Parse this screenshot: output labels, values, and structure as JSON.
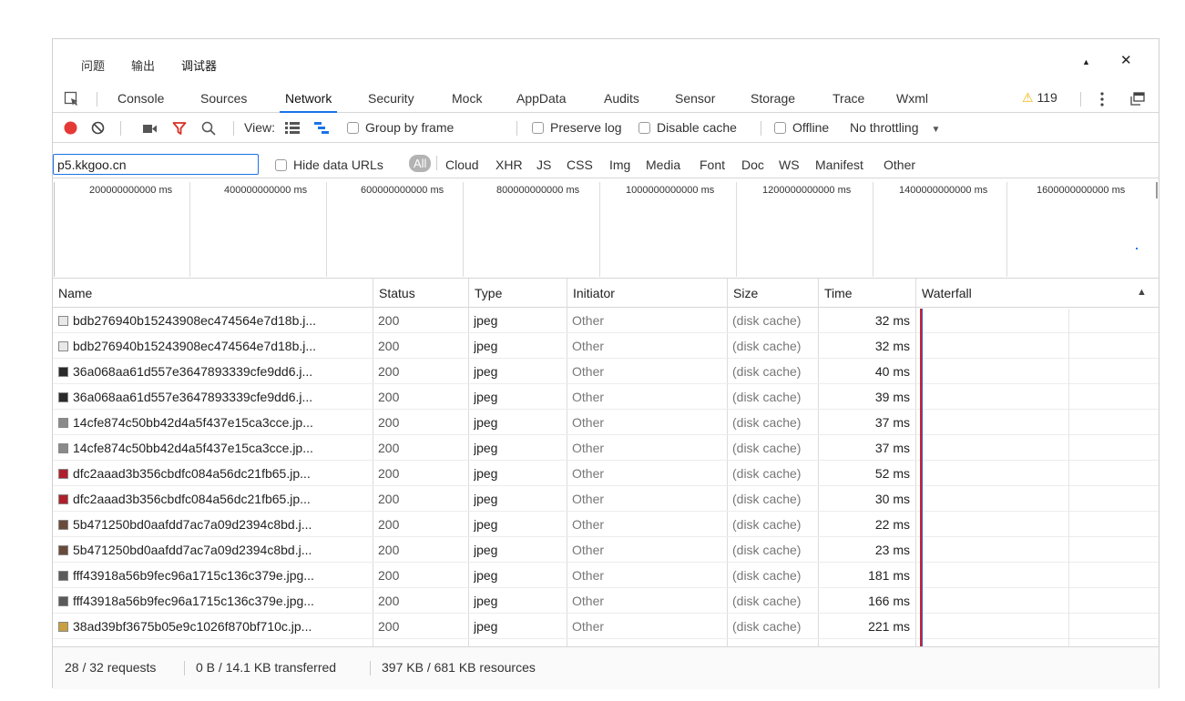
{
  "title_tabs": [
    {
      "label": "问题"
    },
    {
      "label": "输出"
    },
    {
      "label": "调试器"
    }
  ],
  "title_controls": {
    "collapse": "▲",
    "close": "✕"
  },
  "devtools_tabs": [
    {
      "label": "Console"
    },
    {
      "label": "Sources"
    },
    {
      "label": "Network"
    },
    {
      "label": "Security"
    },
    {
      "label": "Mock"
    },
    {
      "label": "AppData"
    },
    {
      "label": "Audits"
    },
    {
      "label": "Sensor"
    },
    {
      "label": "Storage"
    },
    {
      "label": "Trace"
    },
    {
      "label": "Wxml"
    }
  ],
  "warnings": {
    "icon": "⚠",
    "count": "119"
  },
  "toolbar": {
    "view_label": "View:",
    "group_by_frame": "Group by frame",
    "preserve_log": "Preserve log",
    "disable_cache": "Disable cache",
    "offline": "Offline",
    "throttling": "No throttling",
    "throttle_arrow": "▼"
  },
  "filter": {
    "value": "p5.kkgoo.cn",
    "hide_data_urls": "Hide data URLs",
    "all": "All",
    "types": [
      "Cloud",
      "XHR",
      "JS",
      "CSS",
      "Img",
      "Media",
      "Font",
      "Doc",
      "WS",
      "Manifest",
      "Other"
    ]
  },
  "overview_ticks": [
    "200000000000 ms",
    "400000000000 ms",
    "600000000000 ms",
    "800000000000 ms",
    "1000000000000 ms",
    "1200000000000 ms",
    "1400000000000 ms",
    "1600000000000 ms"
  ],
  "columns": {
    "name": "Name",
    "status": "Status",
    "type": "Type",
    "initiator": "Initiator",
    "size": "Size",
    "time": "Time",
    "waterfall": "Waterfall",
    "sort_arrow": "▲"
  },
  "rows": [
    {
      "name": "bdb276940b15243908ec474564e7d18b.j...",
      "status": "200",
      "type": "jpeg",
      "initiator": "Other",
      "size": "(disk cache)",
      "time": "32 ms",
      "icon_color": "#e8e8e8"
    },
    {
      "name": "bdb276940b15243908ec474564e7d18b.j...",
      "status": "200",
      "type": "jpeg",
      "initiator": "Other",
      "size": "(disk cache)",
      "time": "32 ms",
      "icon_color": "#e8e8e8"
    },
    {
      "name": "36a068aa61d557e3647893339cfe9dd6.j...",
      "status": "200",
      "type": "jpeg",
      "initiator": "Other",
      "size": "(disk cache)",
      "time": "40 ms",
      "icon_color": "#2a2a2a"
    },
    {
      "name": "36a068aa61d557e3647893339cfe9dd6.j...",
      "status": "200",
      "type": "jpeg",
      "initiator": "Other",
      "size": "(disk cache)",
      "time": "39 ms",
      "icon_color": "#2a2a2a"
    },
    {
      "name": "14cfe874c50bb42d4a5f437e15ca3cce.jp...",
      "status": "200",
      "type": "jpeg",
      "initiator": "Other",
      "size": "(disk cache)",
      "time": "37 ms",
      "icon_color": "#8a8a8a"
    },
    {
      "name": "14cfe874c50bb42d4a5f437e15ca3cce.jp...",
      "status": "200",
      "type": "jpeg",
      "initiator": "Other",
      "size": "(disk cache)",
      "time": "37 ms",
      "icon_color": "#8a8a8a"
    },
    {
      "name": "dfc2aaad3b356cbdfc084a56dc21fb65.jp...",
      "status": "200",
      "type": "jpeg",
      "initiator": "Other",
      "size": "(disk cache)",
      "time": "52 ms",
      "icon_color": "#b0202a"
    },
    {
      "name": "dfc2aaad3b356cbdfc084a56dc21fb65.jp...",
      "status": "200",
      "type": "jpeg",
      "initiator": "Other",
      "size": "(disk cache)",
      "time": "30 ms",
      "icon_color": "#b0202a"
    },
    {
      "name": "5b471250bd0aafdd7ac7a09d2394c8bd.j...",
      "status": "200",
      "type": "jpeg",
      "initiator": "Other",
      "size": "(disk cache)",
      "time": "22 ms",
      "icon_color": "#6a4a3a"
    },
    {
      "name": "5b471250bd0aafdd7ac7a09d2394c8bd.j...",
      "status": "200",
      "type": "jpeg",
      "initiator": "Other",
      "size": "(disk cache)",
      "time": "23 ms",
      "icon_color": "#6a4a3a"
    },
    {
      "name": "fff43918a56b9fec96a1715c136c379e.jpg...",
      "status": "200",
      "type": "jpeg",
      "initiator": "Other",
      "size": "(disk cache)",
      "time": "181 ms",
      "icon_color": "#5a5a5a"
    },
    {
      "name": "fff43918a56b9fec96a1715c136c379e.jpg...",
      "status": "200",
      "type": "jpeg",
      "initiator": "Other",
      "size": "(disk cache)",
      "time": "166 ms",
      "icon_color": "#5a5a5a"
    },
    {
      "name": "38ad39bf3675b05e9c1026f870bf710c.jp...",
      "status": "200",
      "type": "jpeg",
      "initiator": "Other",
      "size": "(disk cache)",
      "time": "221 ms",
      "icon_color": "#c9a040"
    }
  ],
  "status": {
    "requests": "28 / 32 requests",
    "transferred": "0 B / 14.1 KB transferred",
    "resources": "397 KB / 681 KB resources"
  },
  "colors": {
    "accent": "#1a73e8",
    "record": "#e53935",
    "filter_icon": "#d93025",
    "warning": "#f4b400"
  }
}
